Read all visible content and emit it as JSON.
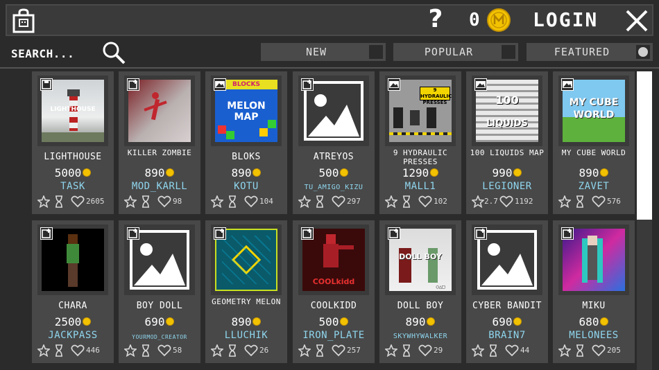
{
  "header": {
    "help_label": "?",
    "coin_count": "0",
    "login_label": "LOGIN"
  },
  "filters": {
    "search_label": "SEARCH...",
    "buttons": [
      {
        "label": "NEW",
        "state": "off"
      },
      {
        "label": "POPULAR",
        "state": "off"
      },
      {
        "label": "FEATURED",
        "state": "on"
      }
    ]
  },
  "colors": {
    "background": "#2b2b2b",
    "card": "#484848",
    "author_text": "#8fd6ee",
    "coin": "#f2c200"
  },
  "items": [
    {
      "title": "LIGHTHOUSE",
      "price": "5000",
      "author": "TASK",
      "rating": "",
      "likes": "2605",
      "badge": "save-icon",
      "thumb": "lighthouse",
      "thumb_text": "LIGHTHOUSE"
    },
    {
      "title": "KILLER ZOMBIE",
      "price": "890",
      "author": "MOD_KARLL",
      "rating": "",
      "likes": "98",
      "badge": "add-icon",
      "thumb": "zombie",
      "thumb_text": ""
    },
    {
      "title": "BLOKS",
      "price": "890",
      "author": "KOTU",
      "rating": "",
      "likes": "104",
      "badge": "picture-icon",
      "thumb": "bloks",
      "thumb_text": "MELON MAP"
    },
    {
      "title": "ATREYOS",
      "price": "500",
      "author": "TU_AMIGO_KIZU",
      "rating": "",
      "likes": "297",
      "badge": "add-icon",
      "thumb": "placeholder",
      "thumb_text": ""
    },
    {
      "title": "9 HYDRAULIC PRESSES",
      "price": "1290",
      "author": "MALL1",
      "rating": "",
      "likes": "102",
      "badge": "picture-icon",
      "thumb": "presses",
      "thumb_text": "9 HYDRAULIC PRESSES"
    },
    {
      "title": "100 LIQUIDS MAP",
      "price": "990",
      "author": "LEGIONER",
      "rating": "2.7",
      "likes": "1192",
      "badge": "picture-icon",
      "thumb": "liquids",
      "thumb_text": "100 LIQUIDS"
    },
    {
      "title": "MY CUBE WORLD",
      "price": "890",
      "author": "ZAVET",
      "rating": "",
      "likes": "576",
      "badge": "picture-icon",
      "thumb": "cube",
      "thumb_text": "MY CUBE WORLD"
    },
    {
      "title": "CHARA",
      "price": "2500",
      "author": "JACKPASS",
      "rating": "",
      "likes": "446",
      "badge": "add-icon",
      "thumb": "chara",
      "thumb_text": ""
    },
    {
      "title": "BOY DOLL",
      "price": "690",
      "author": "YOURMOD_CREATOR",
      "rating": "",
      "likes": "58",
      "badge": "add-icon",
      "thumb": "placeholder",
      "thumb_text": ""
    },
    {
      "title": "GEOMETRY MELON",
      "price": "890",
      "author": "LLUCHIK",
      "rating": "",
      "likes": "26",
      "badge": "add-icon",
      "thumb": "geometry",
      "thumb_text": ""
    },
    {
      "title": "COOLKIDD",
      "price": "500",
      "author": "IRON_PLATE",
      "rating": "",
      "likes": "257",
      "badge": "add-icon",
      "thumb": "coolkidd",
      "thumb_text": "COOLkidd"
    },
    {
      "title": "DOLL BOY",
      "price": "890",
      "author": "SKYWHYWALKER",
      "rating": "",
      "likes": "29",
      "badge": "add-icon",
      "thumb": "dollboy",
      "thumb_text": "DOLL BOY"
    },
    {
      "title": "CYBER BANDIT",
      "price": "690",
      "author": "BRAIN7",
      "rating": "",
      "likes": "44",
      "badge": "add-icon",
      "thumb": "placeholder",
      "thumb_text": ""
    },
    {
      "title": "MIKU",
      "price": "680",
      "author": "MELONEES",
      "rating": "",
      "likes": "205",
      "badge": "add-icon",
      "thumb": "miku",
      "thumb_text": ""
    }
  ]
}
